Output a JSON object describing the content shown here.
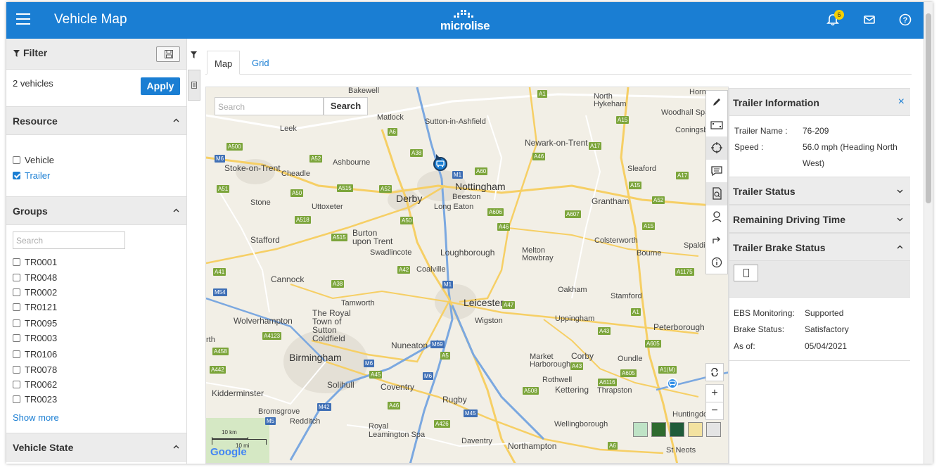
{
  "header": {
    "title": "Vehicle Map",
    "logo_text": "microlise",
    "notification_count": "6",
    "accent": "#1a7ed3"
  },
  "sidebar": {
    "filter_title": "Filter",
    "vehicles_count": "2 vehicles",
    "apply_label": "Apply",
    "resource": {
      "title": "Resource",
      "options": [
        {
          "label": "Vehicle",
          "checked": false
        },
        {
          "label": "Trailer",
          "checked": true
        }
      ]
    },
    "groups": {
      "title": "Groups",
      "search_placeholder": "Search",
      "items": [
        "TR0001",
        "TR0048",
        "TR0002",
        "TR0121",
        "TR0095",
        "TR0003",
        "TR0106",
        "TR0078",
        "TR0062",
        "TR0023"
      ],
      "show_more": "Show more"
    },
    "vehicle_state": {
      "title": "Vehicle State"
    }
  },
  "tabs": [
    {
      "label": "Map",
      "active": true
    },
    {
      "label": "Grid",
      "active": false
    }
  ],
  "map": {
    "search_placeholder": "Search",
    "search_button": "Search",
    "scale_km": "10 km",
    "scale_mi": "10 mi",
    "attribution": "Google",
    "towns": {
      "bakewell": "Bakewell",
      "matlock": "Matlock",
      "sutton_in_ashfield": "Sutton-in-Ashfield",
      "north_hykeham": "North Hykeham",
      "horn": "Horn",
      "woodhall_spa": "Woodhall Spa",
      "coningsby": "Coningsb",
      "leek": "Leek",
      "newark": "Newark-on-Trent",
      "stoke": "Stoke-on-Trent",
      "cheadle": "Cheadle",
      "ashbourne": "Ashbourne",
      "sleaford": "Sleaford",
      "nottingham": "Nottingham",
      "beeston": "Beeston",
      "derby": "Derby",
      "long_eaton": "Long Eaton",
      "grantham": "Grantham",
      "stone": "Stone",
      "uttoxeter": "Uttoxeter",
      "burton": "Burton\nupon Trent",
      "stafford": "Stafford",
      "swadlincote": "Swadlincote",
      "loughborough": "Loughborough",
      "melton": "Melton\nMowbray",
      "colsterworth": "Colsterworth",
      "bourne": "Bourne",
      "spalding": "Spaldi",
      "cannock": "Cannock",
      "coalville": "Coalville",
      "oakham": "Oakham",
      "tamworth": "Tamworth",
      "leicester": "Leicester",
      "stamford": "Stamford",
      "wolverhampton": "Wolverhampton",
      "royal_town": "The Royal\nTown of\nSutton\nColdfield",
      "wigston": "Wigston",
      "uppingham": "Uppingham",
      "peterborough": "Peterborough",
      "rth": "rth",
      "birmingham": "Birmingham",
      "nuneaton": "Nuneaton",
      "corby": "Corby",
      "market_harborough": "Market\nHarborough",
      "oundle": "Oundle",
      "solihull": "Solihull",
      "coventry": "Coventry",
      "rothwell": "Rothwell",
      "kettering": "Kettering",
      "thrapston": "Thrapston",
      "kidderminster": "Kidderminster",
      "rugby": "Rugby",
      "bromsgrove": "Bromsgrove",
      "redditch": "Redditch",
      "huntingdon": "Huntingdo",
      "wellingborough": "Wellingborough",
      "royal_leamington": "Royal\nLeamington Spa",
      "daventry": "Daventry",
      "northampton": "Northampton",
      "st_neots": "St Neots"
    }
  },
  "panel": {
    "trailer_info": {
      "title": "Trailer Information",
      "name_label": "Trailer Name :",
      "name_value": "76-209",
      "speed_label": "Speed :",
      "speed_value_1": "56.0 mph (Heading North",
      "speed_value_2": "West)"
    },
    "trailer_status": {
      "title": "Trailer Status"
    },
    "remaining_driving": {
      "title": "Remaining Driving Time"
    },
    "brake_status": {
      "title": "Trailer Brake Status",
      "ebs_label": "EBS Monitoring:",
      "ebs_value": "Supported",
      "brake_label": "Brake Status:",
      "brake_value": "Satisfactory",
      "asof_label": "As of:",
      "asof_value": "05/04/2021"
    }
  }
}
